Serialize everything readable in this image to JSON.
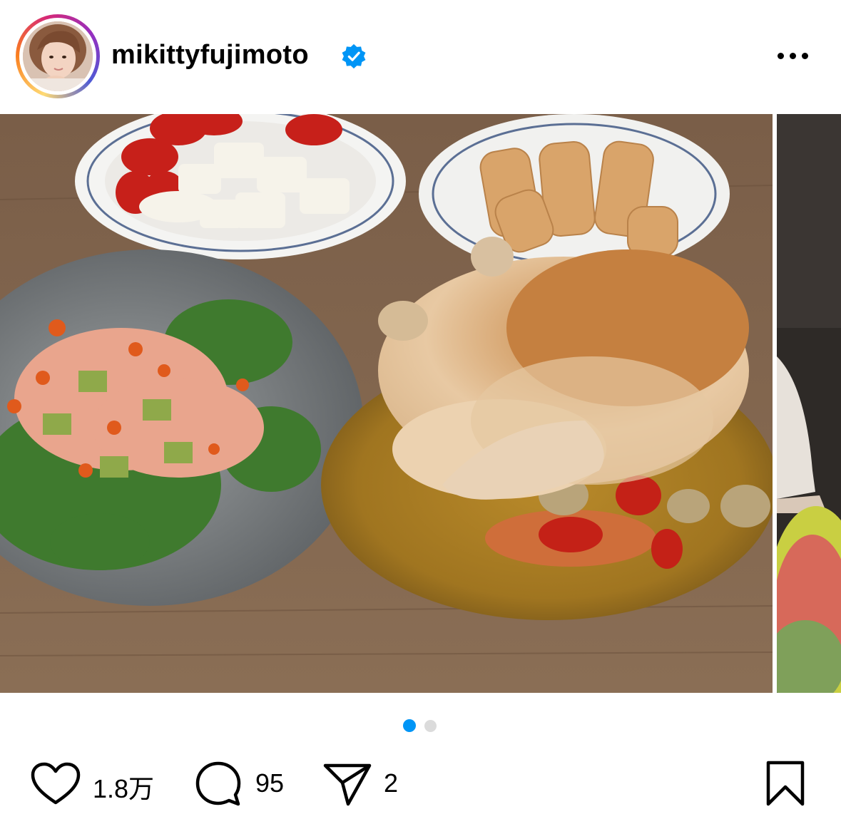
{
  "post": {
    "username": "mikittyfujimoto",
    "verified": true,
    "avatar_icon": "profile-photo",
    "more_icon": "more-horizontal-icon"
  },
  "carousel": {
    "current": 1,
    "total": 2,
    "active_dot_color": "#0095f6",
    "inactive_dot_color": "#dbdbdb"
  },
  "actions": {
    "likes": "1.8万",
    "comments": "95",
    "shares": "2",
    "like_icon": "heart-icon",
    "comment_icon": "comment-icon",
    "share_icon": "send-icon",
    "save_icon": "bookmark-icon"
  },
  "colors": {
    "verified_badge": "#0095f6",
    "text": "#000000",
    "background": "#ffffff"
  }
}
